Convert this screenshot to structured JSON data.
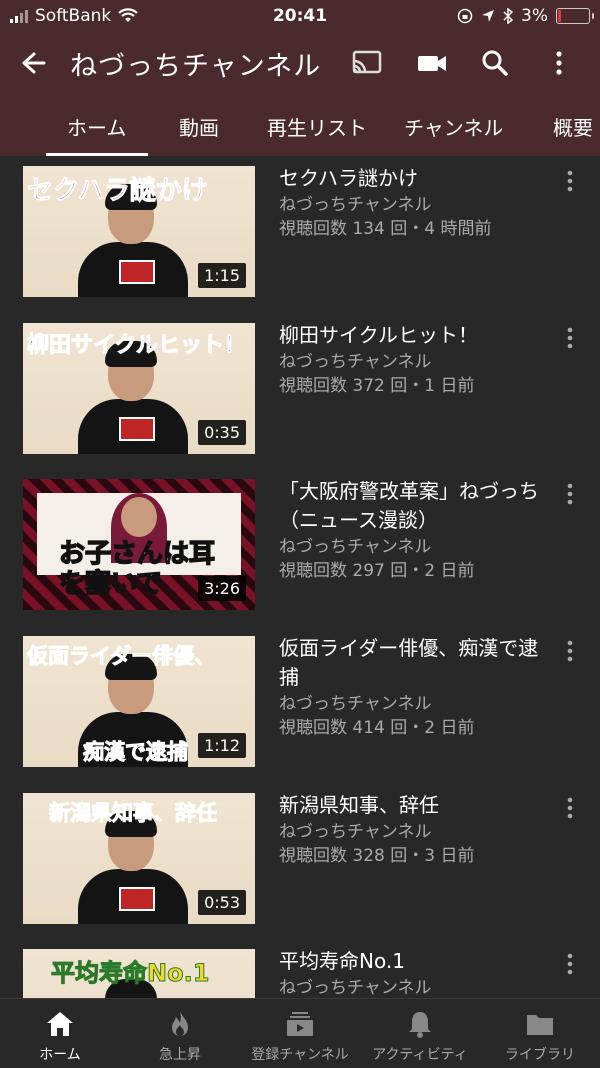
{
  "status": {
    "carrier": "SoftBank",
    "time": "20:41",
    "battery": "3%"
  },
  "appbar": {
    "title": "ねづっちチャンネル"
  },
  "tabs": [
    "ホーム",
    "動画",
    "再生リスト",
    "チャンネル",
    "概要"
  ],
  "videos": [
    {
      "title": "セクハラ謎かけ",
      "channel": "ねづっちチャンネル",
      "stats": "視聴回数 134 回・4 時間前",
      "duration": "1:15",
      "thumb_text": "セクハラ謎かけ"
    },
    {
      "title": "柳田サイクルヒット！",
      "channel": "ねづっちチャンネル",
      "stats": "視聴回数 372 回・1 日前",
      "duration": "0:35",
      "thumb_text": "柳田サイクルヒット！"
    },
    {
      "title": "「大阪府警改革案」ねづっち（ニュース漫談）",
      "channel": "ねづっちチャンネル",
      "stats": "視聴回数 297 回・2 日前",
      "duration": "3:26",
      "thumb_text": "お子さんは耳を塞いで"
    },
    {
      "title": "仮面ライダー俳優、痴漢で逮捕",
      "channel": "ねづっちチャンネル",
      "stats": "視聴回数 414 回・2 日前",
      "duration": "1:12",
      "thumb_text": "仮面ライダー俳優、",
      "thumb_text2": "痴漢で逮捕"
    },
    {
      "title": "新潟県知事、辞任",
      "channel": "ねづっちチャンネル",
      "stats": "視聴回数 328 回・3 日前",
      "duration": "0:53",
      "thumb_text": "新潟県知事、辞任"
    },
    {
      "title": "平均寿命No.1",
      "channel": "ねづっちチャンネル",
      "stats": "",
      "duration": "",
      "thumb_text": "平均寿命No.1"
    }
  ],
  "bottom_nav": [
    "ホーム",
    "急上昇",
    "登録チャンネル",
    "アクティビティ",
    "ライブラリ"
  ],
  "colors": {
    "header_bg": "#4a2a2c",
    "body_bg": "#282828",
    "secondary_text": "#aaaaaa"
  }
}
